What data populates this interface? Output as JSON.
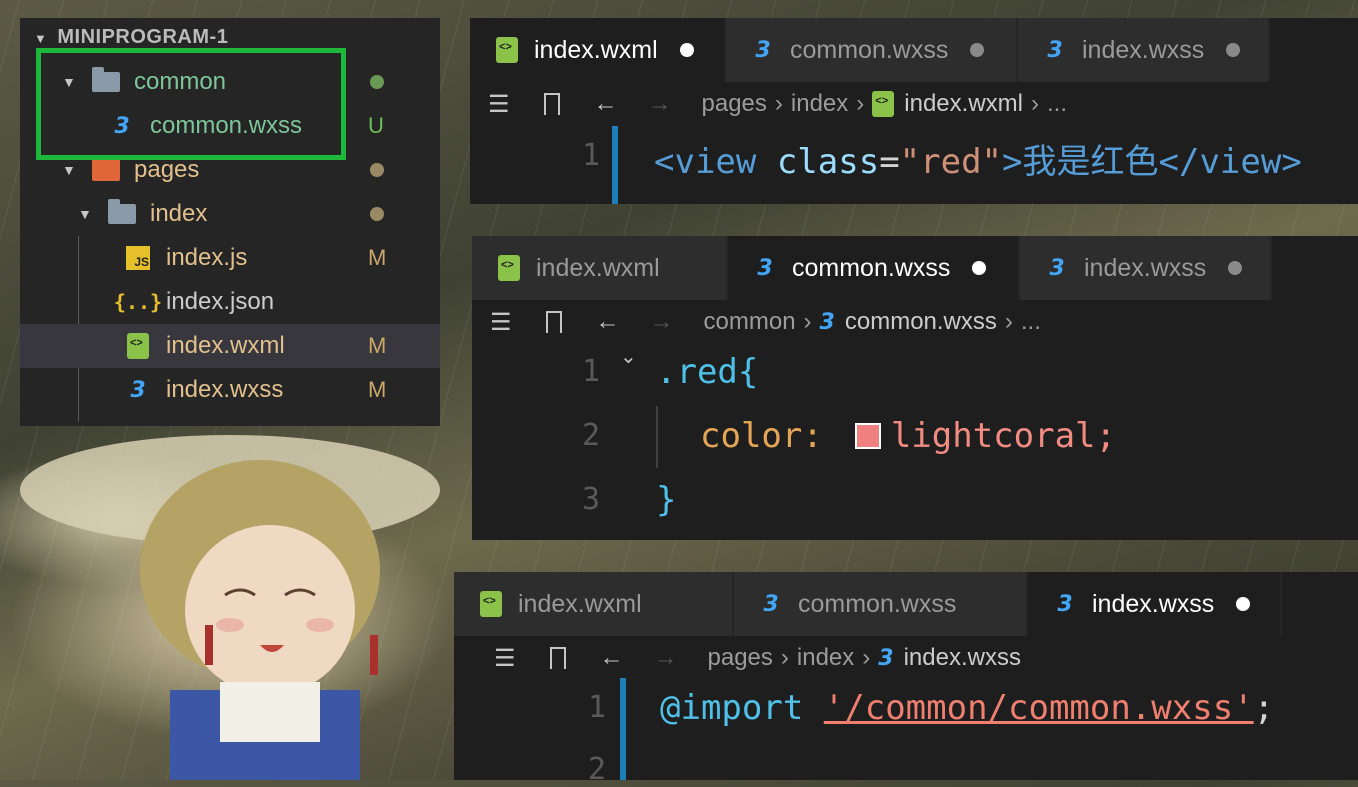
{
  "explorer": {
    "title": "MINIPROGRAM-1",
    "items": [
      {
        "label": "common",
        "status": "",
        "status_color": "#6a9955"
      },
      {
        "label": "common.wxss",
        "status": "U"
      },
      {
        "label": "pages",
        "status": ""
      },
      {
        "label": "index",
        "status": ""
      },
      {
        "label": "index.js",
        "status": "M"
      },
      {
        "label": "index.json",
        "status": ""
      },
      {
        "label": "index.wxml",
        "status": "M"
      },
      {
        "label": "index.wxss",
        "status": "M"
      }
    ]
  },
  "pane1": {
    "tabs": [
      {
        "label": "index.wxml",
        "icon": "wxml-icon"
      },
      {
        "label": "common.wxss",
        "icon": "css-icon"
      },
      {
        "label": "index.wxss",
        "icon": "css-icon"
      }
    ],
    "breadcrumb": {
      "p1": "pages",
      "p2": "index",
      "p3": "index.wxml",
      "more": "..."
    },
    "lines": [
      {
        "num": "1",
        "t1": "<view",
        "t2": " class",
        "t3": "=",
        "t4": "\"red\"",
        "t5": ">我是红色</view>"
      }
    ]
  },
  "pane2": {
    "tabs": [
      {
        "label": "index.wxml",
        "icon": "wxml-icon"
      },
      {
        "label": "common.wxss",
        "icon": "css-icon"
      },
      {
        "label": "index.wxss",
        "icon": "css-icon"
      }
    ],
    "breadcrumb": {
      "p1": "common",
      "p2": "common.wxss",
      "more": "..."
    },
    "lines": [
      {
        "num": "1",
        "text": ".red{"
      },
      {
        "num": "2",
        "prop": "color:",
        "value": "lightcoral;"
      },
      {
        "num": "3",
        "text": "}"
      }
    ]
  },
  "pane3": {
    "tabs": [
      {
        "label": "index.wxml",
        "icon": "wxml-icon"
      },
      {
        "label": "common.wxss",
        "icon": "css-icon"
      },
      {
        "label": "index.wxss",
        "icon": "css-icon"
      }
    ],
    "breadcrumb": {
      "p1": "pages",
      "p2": "index",
      "p3": "index.wxss"
    },
    "lines": [
      {
        "num": "1",
        "kw": "@import",
        "str": "'/common/common.wxss'",
        "end": ";"
      },
      {
        "num": "2"
      }
    ]
  },
  "colors": {
    "highlight_box": "#1db83b",
    "swatch": "#f08080"
  }
}
